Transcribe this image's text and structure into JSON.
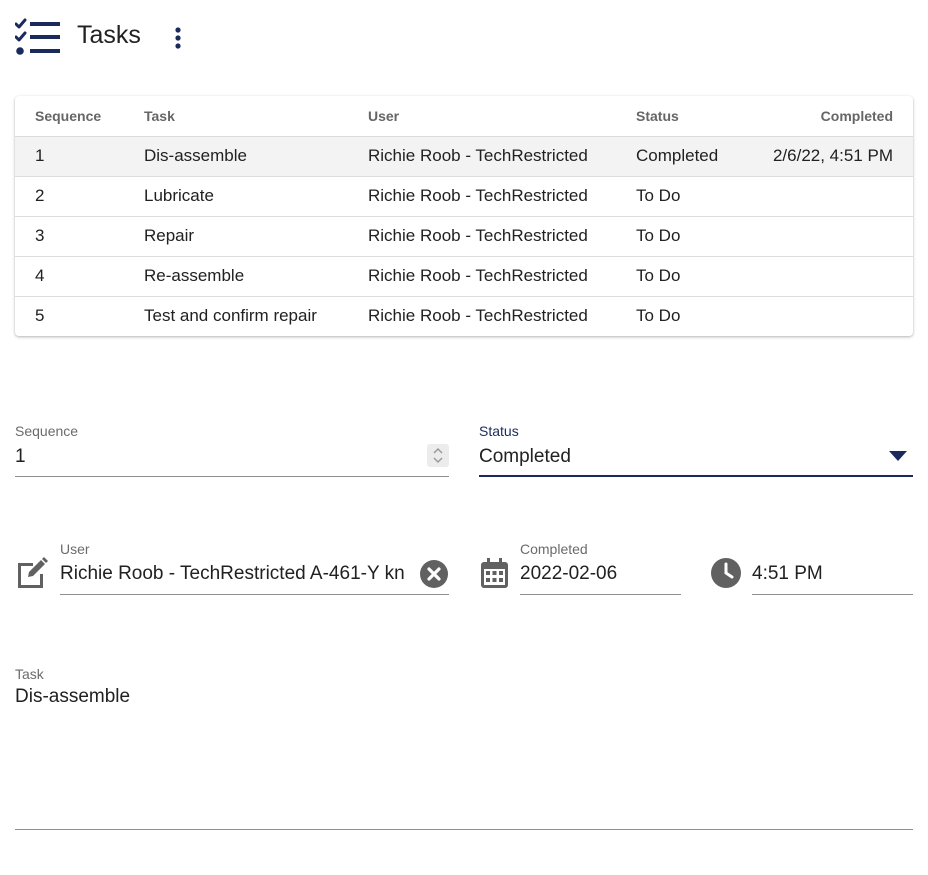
{
  "header": {
    "title": "Tasks",
    "icon": "task-list-icon",
    "menu_icon": "more-vertical-icon"
  },
  "colors": {
    "accent": "#1a2a5c",
    "selected_row": "#f3f3f3"
  },
  "table": {
    "headers": {
      "sequence": "Sequence",
      "task": "Task",
      "user": "User",
      "status": "Status",
      "completed": "Completed"
    },
    "rows": [
      {
        "sequence": "1",
        "task": "Dis-assemble",
        "user": "Richie Roob - TechRestricted",
        "status": "Completed",
        "completed": "2/6/22, 4:51 PM"
      },
      {
        "sequence": "2",
        "task": "Lubricate",
        "user": "Richie Roob - TechRestricted",
        "status": "To Do",
        "completed": ""
      },
      {
        "sequence": "3",
        "task": "Repair",
        "user": "Richie Roob - TechRestricted",
        "status": "To Do",
        "completed": ""
      },
      {
        "sequence": "4",
        "task": "Re-assemble",
        "user": "Richie Roob - TechRestricted",
        "status": "To Do",
        "completed": ""
      },
      {
        "sequence": "5",
        "task": "Test and confirm repair",
        "user": "Richie Roob - TechRestricted",
        "status": "To Do",
        "completed": ""
      }
    ]
  },
  "form": {
    "sequence": {
      "label": "Sequence",
      "value": "1"
    },
    "status": {
      "label": "Status",
      "value": "Completed"
    },
    "user": {
      "label": "User",
      "value": "Richie Roob - TechRestricted A-461-Y kn"
    },
    "completed_date": {
      "label": "Completed",
      "value": "2022-02-06"
    },
    "completed_time": {
      "value": "4:51 PM"
    },
    "task": {
      "label": "Task",
      "value": "Dis-assemble"
    }
  }
}
